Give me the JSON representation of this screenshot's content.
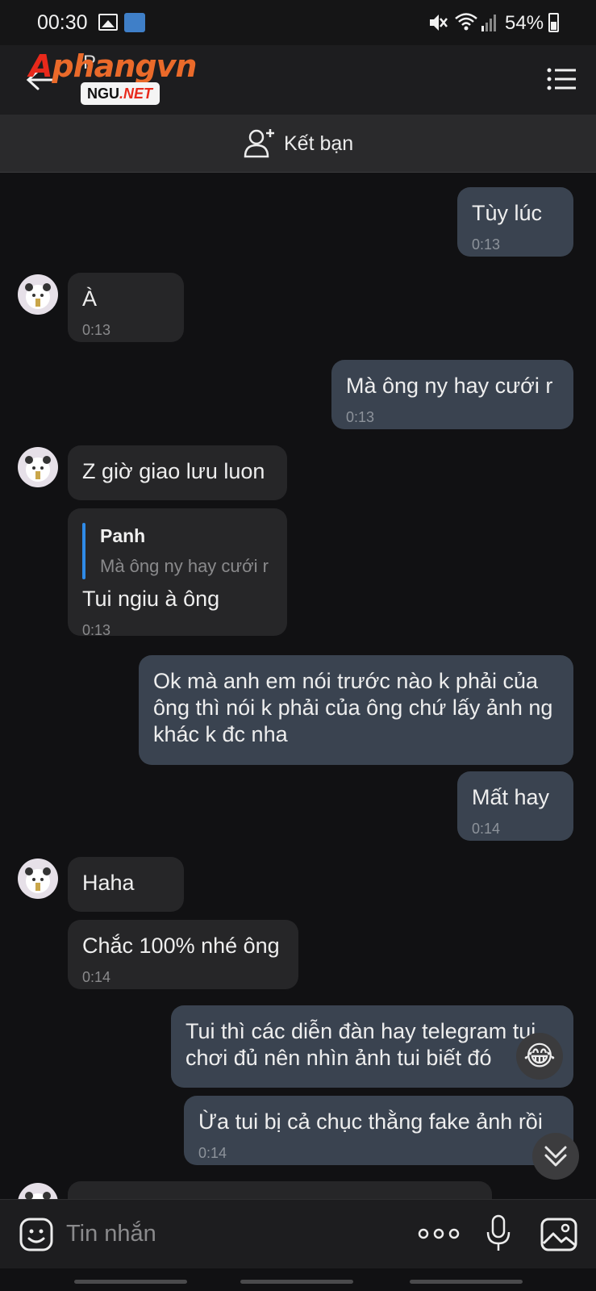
{
  "status_bar": {
    "time": "00:30",
    "battery": "54%"
  },
  "header": {
    "partial_title": "P",
    "logo_text_a": "A",
    "logo_text_rest": "phangvn",
    "logo_badge_ngu": "NGU",
    "logo_badge_net": ".NET"
  },
  "friend_bar": {
    "label": "Kết bạn",
    "icon": "add-user-icon"
  },
  "messages": [
    {
      "dir": "out",
      "text": "Tùy lúc",
      "time": "0:13"
    },
    {
      "dir": "in",
      "text": "À",
      "time": "0:13"
    },
    {
      "dir": "out",
      "text": "Mà ông ny hay cưới r",
      "time": "0:13"
    },
    {
      "dir": "in",
      "text": "Z giờ giao lưu luon"
    },
    {
      "dir": "in",
      "quote_name": "Panh",
      "quote_text": "Mà ông ny hay cưới r",
      "text": "Tui ngiu à ông",
      "time": "0:13"
    },
    {
      "dir": "out",
      "text": "Ok mà anh em nói trước nào k phải của ông thì nói k phải của ông chứ lấy ảnh ng khác k đc nha"
    },
    {
      "dir": "out",
      "text": "Mất hay",
      "time": "0:14"
    },
    {
      "dir": "in",
      "text": "Haha"
    },
    {
      "dir": "in",
      "text": "Chắc 100% nhé ông",
      "time": "0:14"
    },
    {
      "dir": "out",
      "text": "Tui thì các diễn đàn hay telegram tui chơi đủ nên nhìn ảnh tui biết đó"
    },
    {
      "dir": "out",
      "text": "Ừa tui bị cả chục thằng fake ảnh rồi",
      "time": "0:14"
    }
  ],
  "reaction": "😂",
  "input": {
    "placeholder": "Tin nhắn"
  },
  "colors": {
    "outgoing_bubble": "#3a4350",
    "incoming_bubble": "#262628",
    "quote_bar": "#2f8be8",
    "logo_red": "#e8291b"
  }
}
